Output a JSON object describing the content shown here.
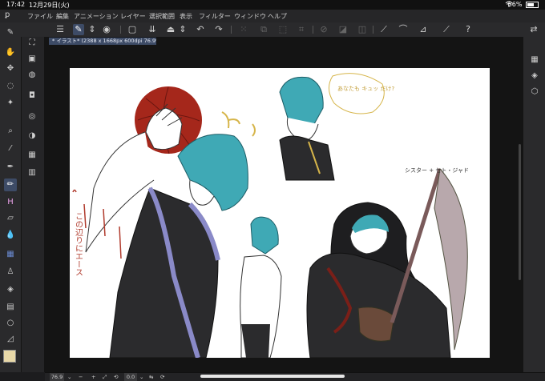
{
  "status_bar": {
    "time": "17:42",
    "date": "12月29日(火)",
    "battery": "66%",
    "wifi_icon": "wifi-icon"
  },
  "menu": {
    "app_icon": "clip-studio-logo-icon",
    "items": [
      "ファイル",
      "編集",
      "アニメーション",
      "レイヤー",
      "選択範囲",
      "表示",
      "フィルター",
      "ウィンドウ",
      "ヘルプ"
    ]
  },
  "document": {
    "tab_title": "* イラスト* (2388 x 1668px 600dpi 76.9%)"
  },
  "bottom_bar": {
    "zoom": "76.9",
    "rotation": "0.0"
  },
  "drawing_text": {
    "speech_bubble": "あなたも キュッ だけ?",
    "caption_sister": "シスター + セト・ジャド",
    "vertical_note": "この辺りにエース"
  },
  "colors": {
    "accent": "#3d4b66",
    "hair": "#3fa9b5",
    "basketball": "#a5271b",
    "current_color": "#e8d8a8"
  }
}
